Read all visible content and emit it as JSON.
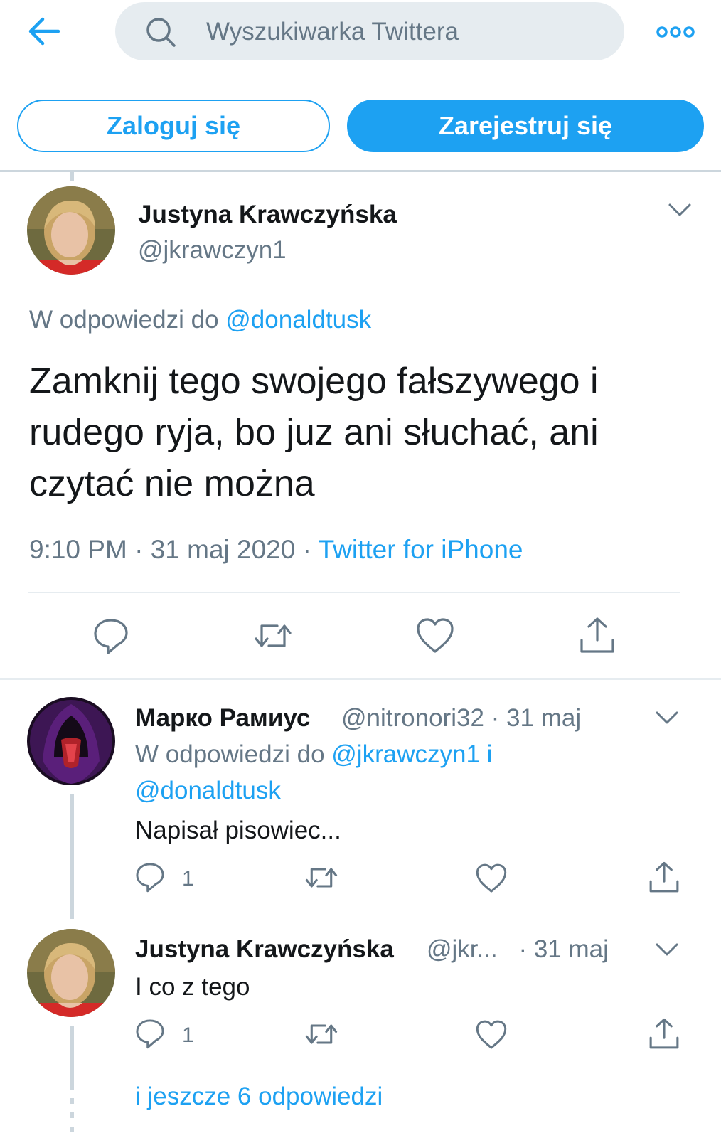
{
  "header": {
    "search_placeholder": "Wyszukiwarka Twittera"
  },
  "auth": {
    "login_label": "Zaloguj się",
    "signup_label": "Zarejestruj się"
  },
  "main_tweet": {
    "author_name": "Justyna Krawczyńska",
    "handle": "@jkrawczyn1",
    "reply_prefix": "W odpowiedzi do",
    "reply_to": "@donaldtusk",
    "text": "Zamknij tego swojego fałszywego i rudego ryja, bo juz ani słuchać, ani czytać nie można",
    "time": "9:10 PM",
    "sep1": "·",
    "date": "31 maj 2020",
    "sep2": "·",
    "source": "Twitter for iPhone"
  },
  "replies": [
    {
      "author_name": "Марко Рамиус",
      "handle": "@nitronori32",
      "sep": "·",
      "date": "31 maj",
      "reply_prefix": "W odpowiedzi do",
      "reply_to_1": "@jkrawczyn1 i",
      "reply_to_2": "@donaldtusk",
      "text": "Napisał pisowiec...",
      "reply_count": "1"
    },
    {
      "author_name": "Justyna Krawczyńska",
      "handle": "@jkr...",
      "sep": "·",
      "date": "31 maj",
      "text": "I co z tego",
      "reply_count": "1"
    }
  ],
  "more_replies": "i jeszcze 6 odpowiedzi",
  "colors": {
    "accent": "#1da1f2",
    "secondary_text": "#657786",
    "divider": "#e6ecf0"
  },
  "icons": [
    "back-arrow-icon",
    "search-icon",
    "more-dots-icon",
    "chevron-down-icon",
    "reply-icon",
    "retweet-icon",
    "like-icon",
    "share-icon"
  ]
}
